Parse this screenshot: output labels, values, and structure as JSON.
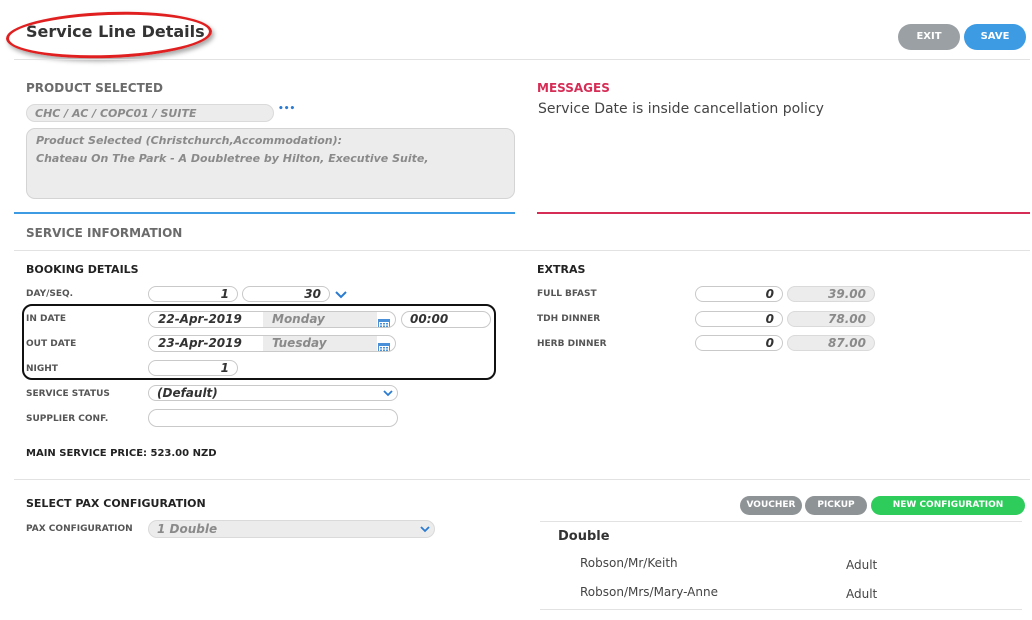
{
  "title": "Service Line Details",
  "header": {
    "exit_label": "EXIT",
    "save_label": "SAVE"
  },
  "product": {
    "heading": "PRODUCT SELECTED",
    "code": "CHC / AC / COPC01 / SUITE",
    "more_label": "•••",
    "description_line1": "Product Selected (Christchurch,Accommodation):",
    "description_line2": "Chateau On The Park - A Doubletree by Hilton, Executive Suite,"
  },
  "messages": {
    "heading": "MESSAGES",
    "text": "Service Date is inside cancellation policy"
  },
  "service_information": {
    "heading": "SERVICE INFORMATION"
  },
  "booking": {
    "heading": "BOOKING DETAILS",
    "day_seq_label": "DAY/SEQ.",
    "day": "1",
    "seq": "30",
    "in_date_label": "IN DATE",
    "in_date": "22-Apr-2019",
    "in_day": "Monday",
    "in_time": "00:00",
    "out_date_label": "OUT DATE",
    "out_date": "23-Apr-2019",
    "out_day": "Tuesday",
    "night_label": "NIGHT",
    "night": "1",
    "service_status_label": "SERVICE STATUS",
    "service_status": "(Default)",
    "supplier_conf_label": "SUPPLIER CONF.",
    "supplier_conf": "",
    "main_price": "MAIN SERVICE PRICE: 523.00 NZD"
  },
  "extras": {
    "heading": "EXTRAS",
    "items": [
      {
        "label": "FULL BFAST",
        "qty": "0",
        "price": "39.00"
      },
      {
        "label": "TDH DINNER",
        "qty": "0",
        "price": "78.00"
      },
      {
        "label": "HERB DINNER",
        "qty": "0",
        "price": "87.00"
      }
    ]
  },
  "pax": {
    "heading": "SELECT PAX CONFIGURATION",
    "config_label": "PAX CONFIGURATION",
    "config_value": "1 Double",
    "voucher_label": "VOUCHER",
    "pickup_label": "PICKUP",
    "new_config_label": "NEW CONFIGURATION",
    "room_type": "Double",
    "passengers": [
      {
        "name": "Robson/Mr/Keith",
        "type": "Adult"
      },
      {
        "name": "Robson/Mrs/Mary-Anne",
        "type": "Adult"
      }
    ]
  },
  "colors": {
    "save_blue": "#3d9be4",
    "exit_gray": "#9aa0a3",
    "new_config_green": "#2ecc5b",
    "messages_red": "#d62d56",
    "annotation_red": "#e02020"
  }
}
